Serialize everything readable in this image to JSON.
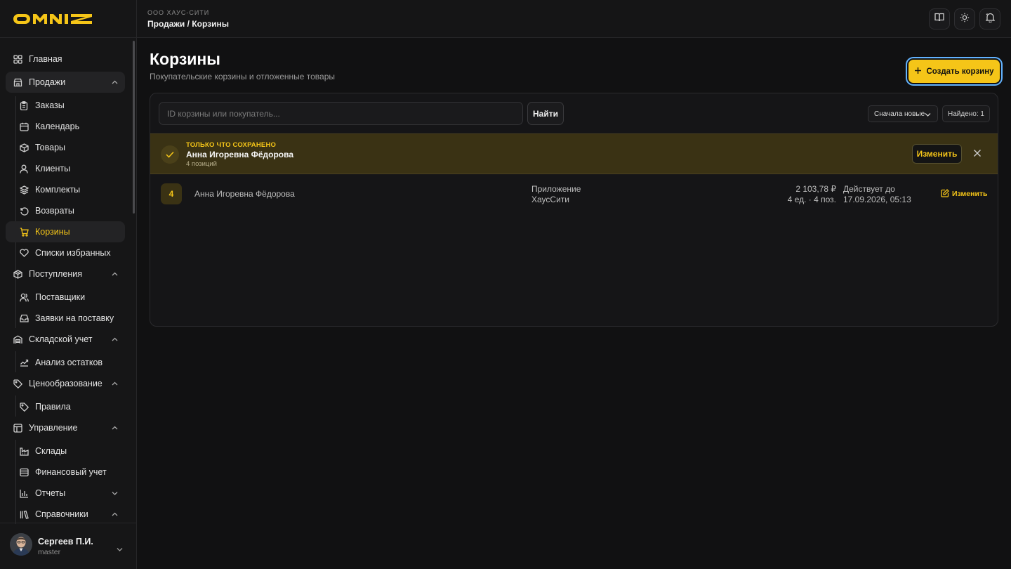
{
  "brand": {
    "logo_text": "OMNIZ",
    "accent": "#f5c518"
  },
  "header": {
    "org": "ООО ХАУС-СИТИ",
    "breadcrumb": "Продажи / Корзины",
    "actions": [
      {
        "icon": "book-icon"
      },
      {
        "icon": "sun-icon"
      },
      {
        "icon": "bell-icon"
      }
    ]
  },
  "sidebar": {
    "items": [
      {
        "label": "Главная",
        "icon": "grid-icon"
      },
      {
        "label": "Продажи",
        "icon": "store-icon",
        "expanded": true
      },
      {
        "label": "Заказы",
        "icon": "clipboard-icon"
      },
      {
        "label": "Календарь",
        "icon": "calendar-icon"
      },
      {
        "label": "Товары",
        "icon": "box-icon"
      },
      {
        "label": "Клиенты",
        "icon": "user-icon"
      },
      {
        "label": "Комплекты",
        "icon": "layers-icon"
      },
      {
        "label": "Возвраты",
        "icon": "undo-icon"
      },
      {
        "label": "Корзины",
        "icon": "cart-icon",
        "active": true
      },
      {
        "label": "Списки избранных",
        "icon": "heart-icon"
      },
      {
        "label": "Поступления",
        "icon": "package-icon",
        "expanded": true
      },
      {
        "label": "Поставщики",
        "icon": "users-icon"
      },
      {
        "label": "Заявки на поставку",
        "icon": "inbox-icon"
      },
      {
        "label": "Складской учет",
        "icon": "warehouse-icon",
        "expanded": true
      },
      {
        "label": "Анализ остатков",
        "icon": "trend-icon"
      },
      {
        "label": "Ценообразование",
        "icon": "tag-icon",
        "expanded": true
      },
      {
        "label": "Правила",
        "icon": "tag-icon"
      },
      {
        "label": "Управление",
        "icon": "layout-icon",
        "expanded": true
      },
      {
        "label": "Склады",
        "icon": "factory-icon"
      },
      {
        "label": "Финансовый учет",
        "icon": "wallet-icon"
      },
      {
        "label": "Отчеты",
        "icon": "bar-chart-icon",
        "expanded": false
      },
      {
        "label": "Справочники",
        "icon": "library-icon",
        "expanded": true
      }
    ],
    "user": {
      "name": "Сергеев П.И.",
      "role": "master"
    }
  },
  "main": {
    "title": "Корзины",
    "subtitle": "Покупательские корзины и отложенные товары",
    "create_label": "Создать корзину",
    "search": {
      "placeholder": "ID корзины или покупатель...",
      "value": "",
      "button": "Найти"
    },
    "sort": {
      "selected": "Сначала новые"
    },
    "found": "Найдено: 1",
    "banner": {
      "tag": "ТОЛЬКО ЧТО СОХРАНЕНО",
      "name": "Анна Игоревна Фёдорова",
      "count": "4 позиций",
      "edit_label": "Изменить"
    },
    "rows": [
      {
        "badge": "4",
        "customer": "Анна Игоревна Фёдорова",
        "source_line1": "Приложение",
        "source_line2": "ХаусСити",
        "sum": "2 103,78 ₽",
        "units": "4 ед. · 4 поз.",
        "valid_line1": "Действует до",
        "valid_line2": "17.09.2026, 05:13",
        "edit_label": "Изменить"
      }
    ]
  }
}
